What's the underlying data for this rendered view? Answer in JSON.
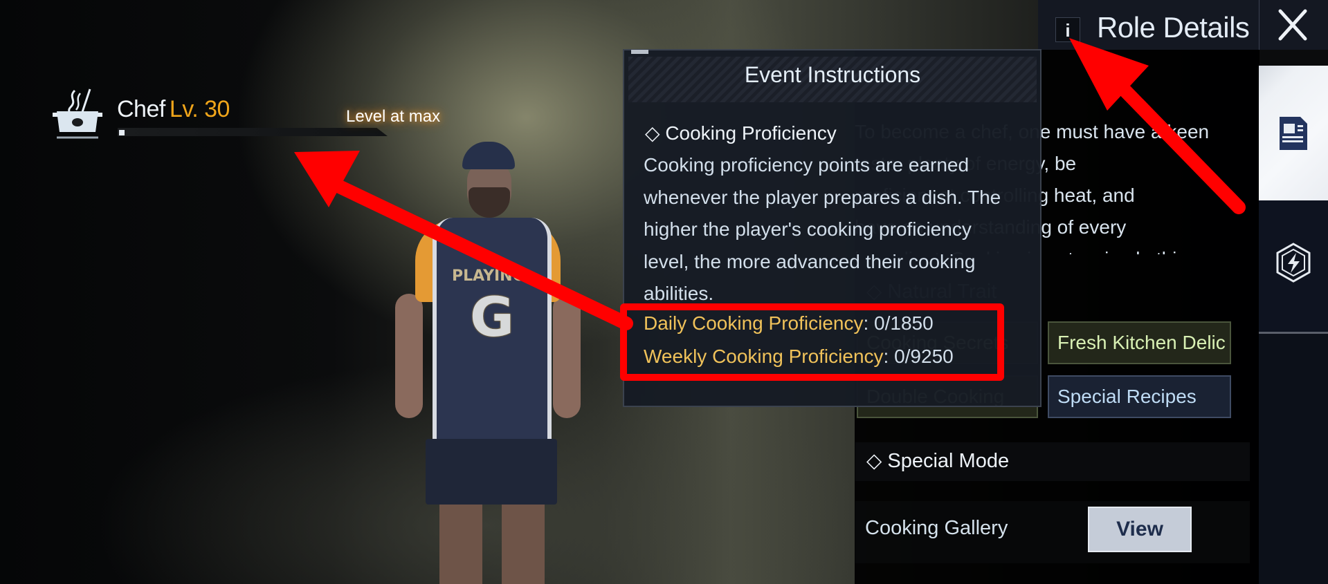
{
  "header": {
    "title": "Role Details",
    "info_icon_label": "i",
    "info_icon": "info-icon",
    "close_icon": "close-icon"
  },
  "role": {
    "icon": "cooking-pot-icon",
    "name": "Chef",
    "level": "Lv. 30",
    "level_status": "Level at max",
    "xp_progress": 0.02
  },
  "description": {
    "lines": [
      "To become a chef, one must have a keen",
      "taste, plenty of energy, be",
      "proficient at controlling heat, and",
      "have an understanding of every",
      "ingredient. Cooking is not a simple thing"
    ]
  },
  "natural_trait": {
    "title": "Natural Trait",
    "items": [
      {
        "label": "Cooking Secrets",
        "style": "green"
      },
      {
        "label": "Fresh Kitchen Delic",
        "style": "green"
      },
      {
        "label": "Double Cooking",
        "style": "green"
      },
      {
        "label": "Special Recipes",
        "style": "blue"
      }
    ]
  },
  "special_mode": {
    "title": "Special Mode",
    "gallery_label": "Cooking Gallery",
    "view_button": "View"
  },
  "side_tabs": [
    {
      "icon": "document-icon",
      "active": true
    },
    {
      "icon": "lightning-hexagon-icon",
      "active": false
    }
  ],
  "popup": {
    "title": "Event Instructions",
    "subtitle": "Cooking Proficiency",
    "body_lines": [
      "Cooking proficiency points are earned",
      "whenever the player prepares a dish. The",
      "higher the player's cooking proficiency",
      "level, the more advanced their cooking",
      "abilities."
    ],
    "stats": [
      {
        "label": "Daily Cooking Proficiency",
        "value": "0/1850"
      },
      {
        "label": "Weekly Cooking Proficiency",
        "value": "0/9250"
      }
    ]
  },
  "annotations": {
    "color": "#ff0000"
  },
  "colors": {
    "level_accent": "#f0a51a",
    "stat_label": "#f0c25a",
    "view_button_bg": "#c5ccd8"
  }
}
